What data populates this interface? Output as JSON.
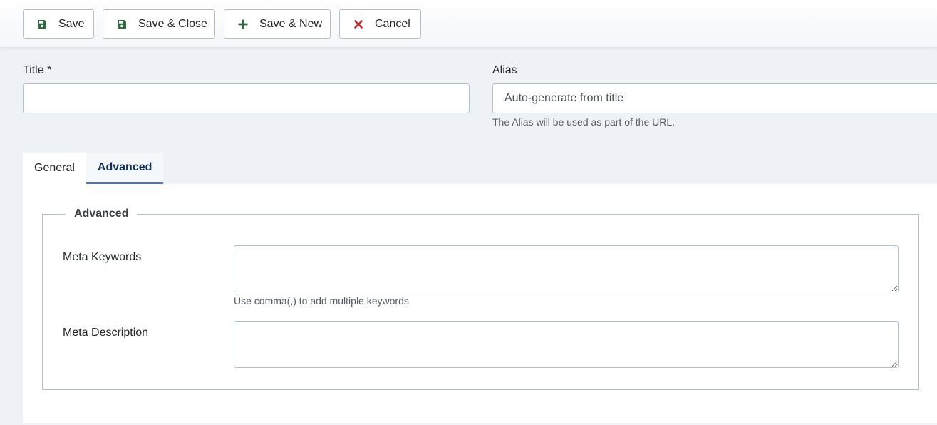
{
  "toolbar": {
    "save_label": "Save",
    "save_close_label": "Save & Close",
    "save_new_label": "Save & New",
    "cancel_label": "Cancel"
  },
  "form": {
    "title_label": "Title *",
    "title_value": "",
    "alias_label": "Alias",
    "alias_placeholder": "Auto-generate from title",
    "alias_help": "The Alias will be used as part of the URL."
  },
  "tabs": [
    {
      "label": "General",
      "active": false
    },
    {
      "label": "Advanced",
      "active": true
    }
  ],
  "advanced": {
    "legend": "Advanced",
    "meta_keywords_label": "Meta Keywords",
    "meta_keywords_value": "",
    "meta_keywords_help": "Use comma(,) to add multiple keywords",
    "meta_description_label": "Meta Description",
    "meta_description_value": ""
  },
  "colors": {
    "save_icon": "#2f6b3c",
    "cancel_icon": "#c52827",
    "tab_active_border": "#4a73b8",
    "page_bg": "#eef2f6"
  }
}
